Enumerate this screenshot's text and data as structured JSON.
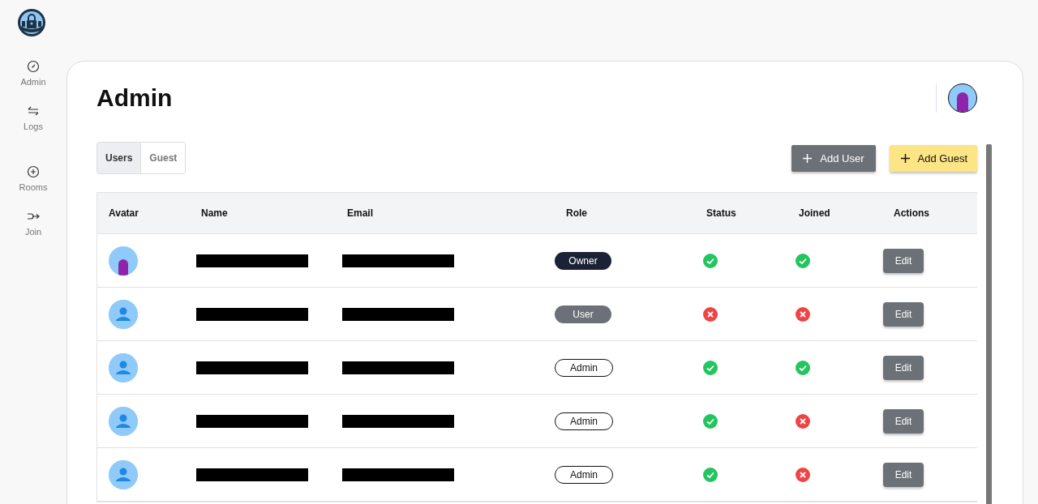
{
  "sidebar": {
    "items": [
      {
        "label": "Admin"
      },
      {
        "label": "Logs"
      },
      {
        "label": "Rooms"
      },
      {
        "label": "Join"
      }
    ]
  },
  "page": {
    "title": "Admin"
  },
  "tabs": [
    {
      "label": "Users",
      "selected": true
    },
    {
      "label": "Guest",
      "selected": false
    }
  ],
  "buttons": [
    {
      "label": "Add User",
      "kind": "secondary"
    },
    {
      "label": "Add Guest",
      "kind": "accent"
    }
  ],
  "table": {
    "columns": [
      "Avatar",
      "Name",
      "Email",
      "Role",
      "Status",
      "Joined",
      "Actions"
    ],
    "rows": [
      {
        "avatar": {
          "kind": "picture"
        },
        "role": {
          "label": "Owner",
          "kind": "dark"
        },
        "status": true,
        "joined": true,
        "action": "Edit"
      },
      {
        "avatar": {
          "kind": "default"
        },
        "role": {
          "label": "User",
          "kind": "grey"
        },
        "status": false,
        "joined": false,
        "action": "Edit"
      },
      {
        "avatar": {
          "kind": "default"
        },
        "role": {
          "label": "Admin",
          "kind": "outline"
        },
        "status": true,
        "joined": true,
        "action": "Edit"
      },
      {
        "avatar": {
          "kind": "default"
        },
        "role": {
          "label": "Admin",
          "kind": "outline"
        },
        "status": true,
        "joined": false,
        "action": "Edit"
      },
      {
        "avatar": {
          "kind": "default"
        },
        "role": {
          "label": "Admin",
          "kind": "outline"
        },
        "status": true,
        "joined": false,
        "action": "Edit"
      }
    ]
  }
}
